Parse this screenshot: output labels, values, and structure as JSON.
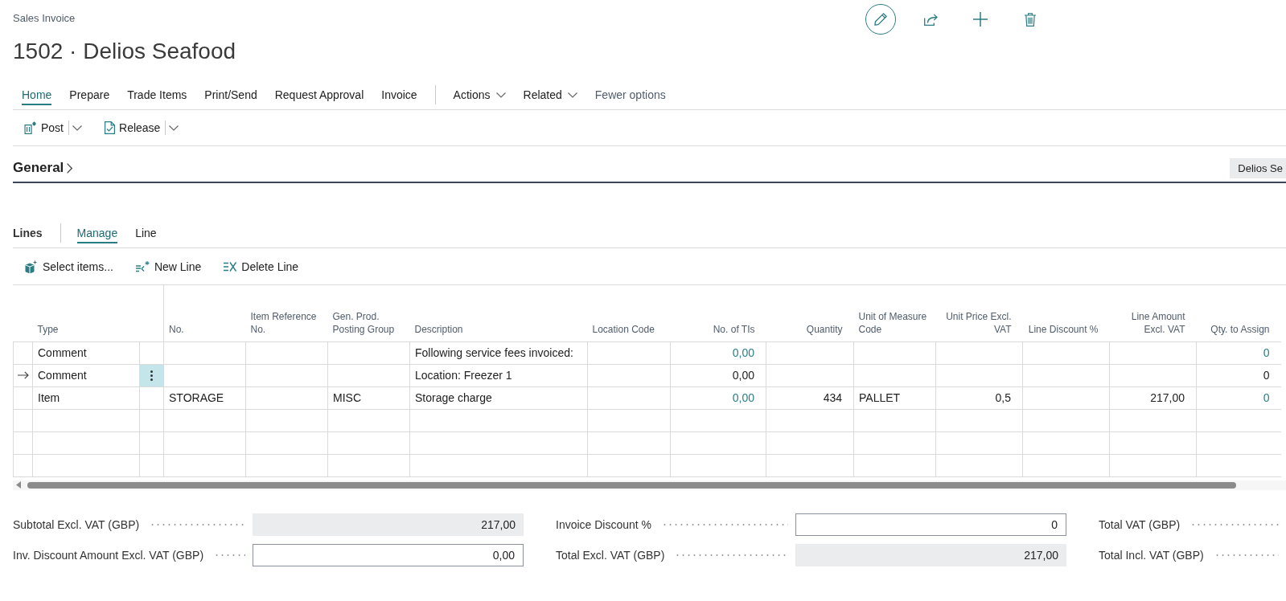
{
  "page": {
    "breadcrumb": "Sales Invoice",
    "title": "1502 · Delios Seafood"
  },
  "action_bar": {
    "tabs": [
      {
        "label": "Home",
        "selected": true
      },
      {
        "label": "Prepare",
        "selected": false
      },
      {
        "label": "Trade Items",
        "selected": false
      },
      {
        "label": "Print/Send",
        "selected": false
      },
      {
        "label": "Request Approval",
        "selected": false
      },
      {
        "label": "Invoice",
        "selected": false
      }
    ],
    "menus": [
      "Actions",
      "Related"
    ],
    "toggle": "Fewer options"
  },
  "toolbar": [
    "Post",
    "Release"
  ],
  "general": {
    "title": "General",
    "expanded": false,
    "summary": "Delios Se"
  },
  "lines": {
    "title": "Lines",
    "tabs": [
      {
        "label": "Manage",
        "selected": true
      },
      {
        "label": "Line",
        "selected": false
      }
    ],
    "actions": [
      "Select items...",
      "New Line",
      "Delete Line"
    ]
  },
  "table": {
    "columns": [
      {
        "label": "Type",
        "kind": "text"
      },
      {
        "label": "No.",
        "kind": "text"
      },
      {
        "label": "Item Reference No.",
        "kind": "text"
      },
      {
        "label": "Gen. Prod. Posting Group",
        "kind": "text"
      },
      {
        "label": "Description",
        "kind": "text"
      },
      {
        "label": "Location Code",
        "kind": "text"
      },
      {
        "label": "No. of TIs",
        "kind": "drilldown"
      },
      {
        "label": "Quantity",
        "kind": "number"
      },
      {
        "label": "Unit of Measure Code",
        "kind": "text"
      },
      {
        "label": "Unit Price Excl. VAT",
        "kind": "number"
      },
      {
        "label": "Line Discount %",
        "kind": "number"
      },
      {
        "label": "Line Amount Excl. VAT",
        "kind": "number"
      },
      {
        "label": "Qty. to Assign",
        "kind": "drilldown"
      }
    ],
    "rows": [
      {
        "selected": false,
        "type": "Comment",
        "description": "Following service fees invoiced:",
        "no_of_tis": "0,00",
        "qty_to_assign": "0"
      },
      {
        "selected": true,
        "type": "Comment",
        "description": "Location: Freezer 1",
        "no_of_tis": "0,00",
        "qty_to_assign": "0"
      },
      {
        "selected": false,
        "type": "Item",
        "no": "STORAGE",
        "gen_prod_posting_group": "MISC",
        "description": "Storage charge",
        "no_of_tis": "0,00",
        "quantity": "434",
        "unit_of_measure_code": "PALLET",
        "unit_price_excl_vat": "0,5",
        "line_amount_excl_vat": "217,00",
        "qty_to_assign": "0"
      }
    ]
  },
  "totals": [
    {
      "fields": [
        {
          "label": "Subtotal Excl. VAT (GBP)",
          "value": "217,00",
          "editable": false
        },
        {
          "label": "Inv. Discount Amount Excl. VAT (GBP)",
          "value": "0,00",
          "editable": true
        }
      ]
    },
    {
      "fields": [
        {
          "label": "Invoice Discount %",
          "value": "0",
          "editable": true
        },
        {
          "label": "Total Excl. VAT (GBP)",
          "value": "217,00",
          "editable": false
        }
      ]
    },
    {
      "fields": [
        {
          "label": "Total VAT (GBP)"
        },
        {
          "label": "Total Incl. VAT (GBP)"
        }
      ]
    }
  ]
}
